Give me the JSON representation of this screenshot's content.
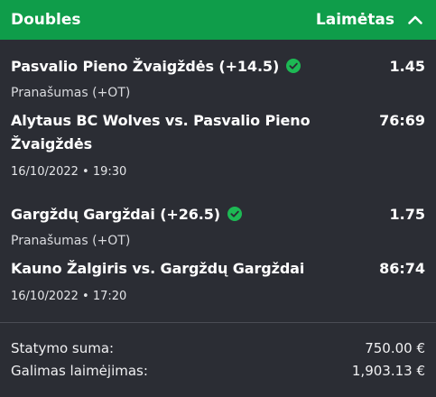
{
  "header": {
    "title": "Doubles",
    "status": "Laimėtas"
  },
  "bets": [
    {
      "selection": "Pasvalio Pieno Žvaigždės (+14.5)",
      "odds": "1.45",
      "market": "Pranašumas (+OT)",
      "event": "Alytaus BC Wolves vs. Pasvalio Pieno Žvaigždės",
      "score": "76:69",
      "datetime": "16/10/2022 • 19:30"
    },
    {
      "selection": "Gargždų Gargždai (+26.5)",
      "odds": "1.75",
      "market": "Pranašumas (+OT)",
      "event": "Kauno Žalgiris vs. Gargždų Gargždai",
      "score": "86:74",
      "datetime": "16/10/2022 • 17:20"
    }
  ],
  "summary": {
    "stake_label": "Statymo suma:",
    "stake_value": "750.00 €",
    "win_label": "Galimas laimėjimas:",
    "win_value": "1,903.13 €"
  },
  "icons": {
    "collapse": "chevron-up-icon",
    "won": "check-circle-icon"
  },
  "colors": {
    "header_bg": "#0f9d4a",
    "card_bg": "#2b2d34",
    "check_green": "#1db954"
  }
}
